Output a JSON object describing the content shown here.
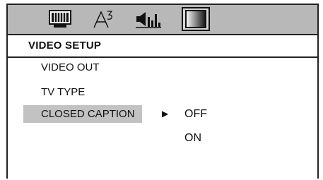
{
  "toolbar": {
    "icons": [
      {
        "name": "tv-monitor-icon"
      },
      {
        "name": "language-icon"
      },
      {
        "name": "audio-speaker-icon"
      },
      {
        "name": "video-setup-icon",
        "selected": true
      }
    ]
  },
  "header": {
    "title": "VIDEO SETUP"
  },
  "menu": {
    "items": [
      {
        "label": "VIDEO  OUT"
      },
      {
        "label": "TV TYPE"
      },
      {
        "label": "CLOSED CAPTION",
        "highlighted": true
      }
    ],
    "submenu_arrow": "▶",
    "options": [
      {
        "label": "OFF"
      },
      {
        "label": "ON"
      }
    ]
  },
  "colors": {
    "toolbar_bg": "#b8b8b8",
    "highlight_bg": "#c2c2c2",
    "border": "#222222"
  }
}
